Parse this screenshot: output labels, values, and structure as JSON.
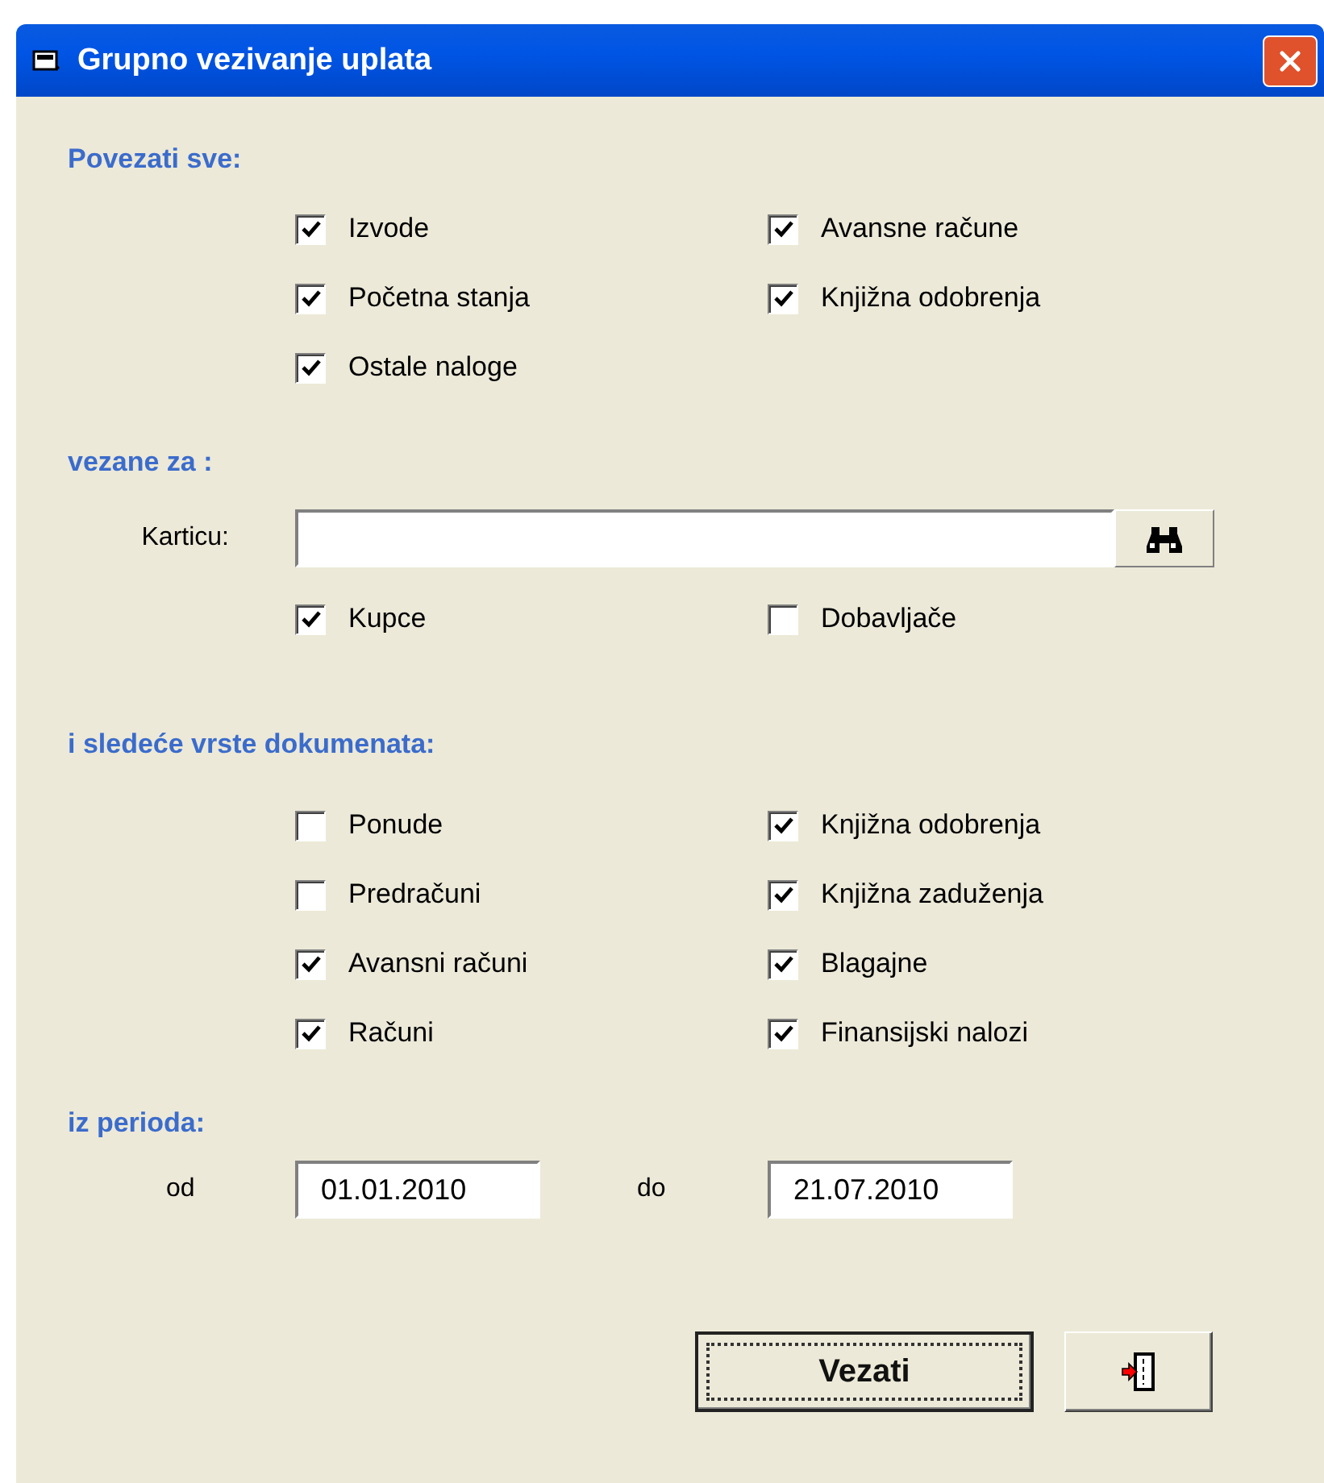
{
  "window": {
    "title": "Grupno vezivanje uplata"
  },
  "link_all": {
    "heading": "Povezati sve:",
    "options": [
      {
        "label": "Izvode",
        "checked": true
      },
      {
        "label": "Avansne račune",
        "checked": true
      },
      {
        "label": "Početna stanja",
        "checked": true
      },
      {
        "label": "Knjižna odobrenja",
        "checked": true
      },
      {
        "label": "Ostale naloge",
        "checked": true
      }
    ]
  },
  "related_to": {
    "heading": "vezane za :",
    "card_label": "Karticu:",
    "options": [
      {
        "label": "Kupce",
        "checked": true
      },
      {
        "label": "Dobavljače",
        "checked": false
      }
    ]
  },
  "document_types": {
    "heading": "i sledeće vrste dokumenata:",
    "options": [
      {
        "label": "Ponude",
        "checked": false
      },
      {
        "label": "Knjižna odobrenja",
        "checked": true
      },
      {
        "label": "Predračuni",
        "checked": false
      },
      {
        "label": "Knjižna zaduženja",
        "checked": true
      },
      {
        "label": "Avansni računi",
        "checked": true
      },
      {
        "label": "Blagajne",
        "checked": true
      },
      {
        "label": "Računi",
        "checked": true
      },
      {
        "label": "Finansijski nalozi",
        "checked": true
      }
    ]
  },
  "period": {
    "heading": "iz perioda:",
    "from_label": "od",
    "from": "01.01.2010",
    "to_label": "do",
    "to": "21.07.2010"
  },
  "buttons": {
    "submit": "Vezati"
  }
}
